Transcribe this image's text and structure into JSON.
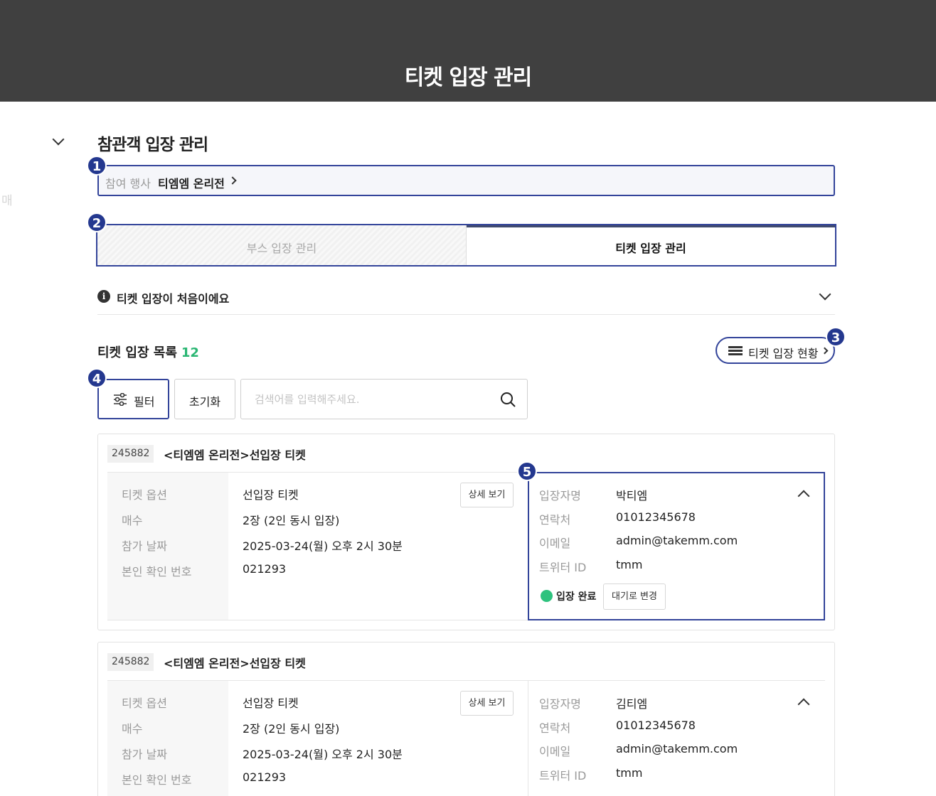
{
  "header": {
    "title": "티켓 입장 관리"
  },
  "ghost_text": "매",
  "section": {
    "title": "참관객 입장 관리"
  },
  "event": {
    "label": "참여 행사",
    "value": "티엠엠 온리전"
  },
  "tabs": [
    {
      "label": "부스 입장 관리",
      "active": false
    },
    {
      "label": "티켓 입장 관리",
      "active": true
    }
  ],
  "notice": {
    "text": "티켓 입장이 처음이에요"
  },
  "list": {
    "title": "티켓 입장 목록",
    "count": "12"
  },
  "status_button": {
    "label": "티켓 입장 현황"
  },
  "toolbar": {
    "filter_label": "필터",
    "reset_label": "초기화",
    "search_placeholder": "검색어를 입력해주세요."
  },
  "badges": [
    "1",
    "2",
    "3",
    "4",
    "5"
  ],
  "cards": [
    {
      "id": "245882",
      "name": "<티엠엠 온리전>선입장 티켓",
      "detail_button": "상세 보기",
      "left": [
        {
          "label": "티켓 옵션",
          "value": "선입장 티켓"
        },
        {
          "label": "매수",
          "value": "2장 (2인 동시 입장)"
        },
        {
          "label": "참가 날짜",
          "value": "2025-03-24(월) 오후 2시 30분"
        },
        {
          "label": "본인 확인 번호",
          "value": "021293"
        }
      ],
      "right": [
        {
          "label": "입장자명",
          "value": "박티엠"
        },
        {
          "label": "연락처",
          "value": "01012345678"
        },
        {
          "label": "이메일",
          "value": "admin@takemm.com"
        },
        {
          "label": "트위터 ID",
          "value": "tmm"
        }
      ],
      "status": "입장 완료",
      "change_button": "대기로 변경"
    },
    {
      "id": "245882",
      "name": "<티엠엠 온리전>선입장 티켓",
      "detail_button": "상세 보기",
      "left": [
        {
          "label": "티켓 옵션",
          "value": "선입장 티켓"
        },
        {
          "label": "매수",
          "value": "2장 (2인 동시 입장)"
        },
        {
          "label": "참가 날짜",
          "value": "2025-03-24(월) 오후 2시 30분"
        },
        {
          "label": "본인 확인 번호",
          "value": "021293"
        }
      ],
      "right": [
        {
          "label": "입장자명",
          "value": "김티엠"
        },
        {
          "label": "연락처",
          "value": "01012345678"
        },
        {
          "label": "이메일",
          "value": "admin@takemm.com"
        },
        {
          "label": "트위터 ID",
          "value": "tmm"
        }
      ]
    }
  ],
  "colors": {
    "header_bg": "#404040",
    "accent": "#33449a",
    "badge": "#24388f",
    "success": "#2ec27e",
    "count": "#2ab673"
  }
}
